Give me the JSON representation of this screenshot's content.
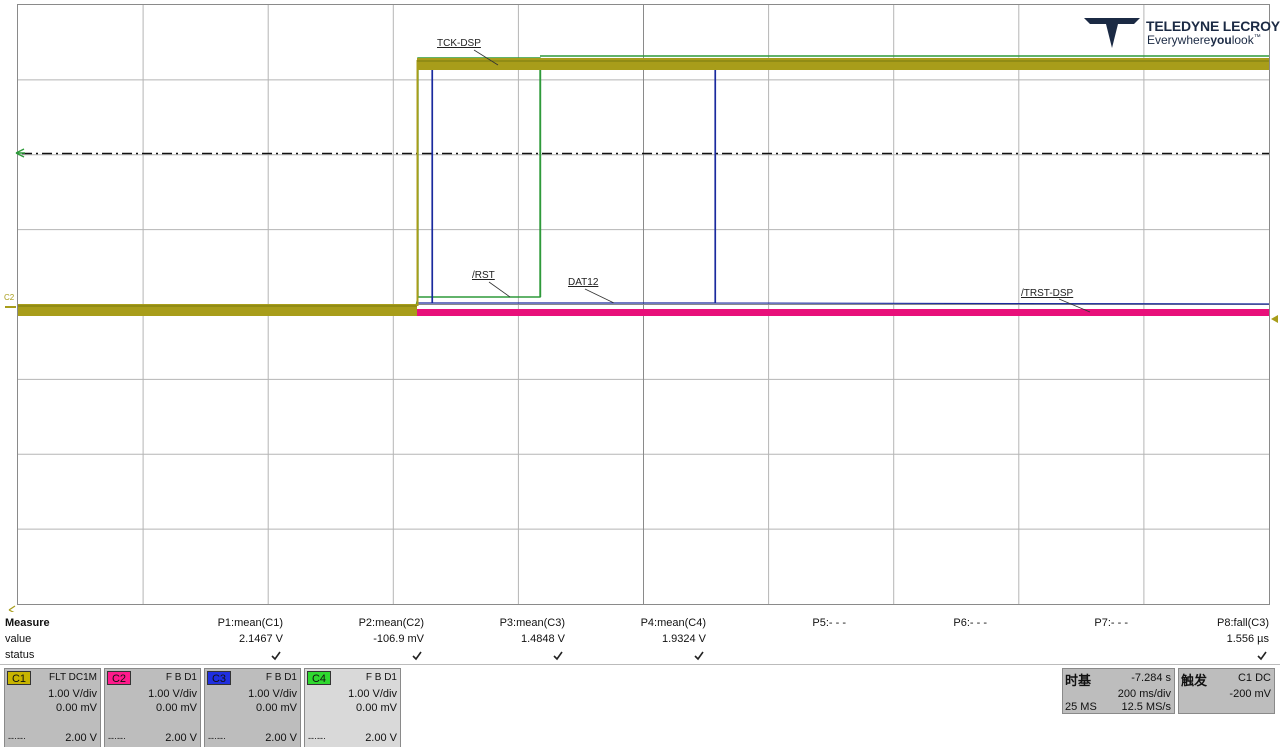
{
  "brand": {
    "name": "TELEDYNE LECROY",
    "tagline_pre": "Everywhere",
    "tagline_bold": "you",
    "tagline_post": "look",
    "tm": "™"
  },
  "trace_labels": {
    "tck": "TCK-DSP",
    "rst": "/RST",
    "dat": "DAT12",
    "trst": "/TRST-DSP",
    "c2_marker": "C2"
  },
  "measure": {
    "header": "Measure",
    "row_value": "value",
    "row_status": "status",
    "params": [
      {
        "name": "P1:mean(C1)",
        "value": "2.1467 V",
        "status": "ok"
      },
      {
        "name": "P2:mean(C2)",
        "value": "-106.9 mV",
        "status": "ok"
      },
      {
        "name": "P3:mean(C3)",
        "value": "1.4848 V",
        "status": "ok"
      },
      {
        "name": "P4:mean(C4)",
        "value": "1.9324 V",
        "status": "ok"
      },
      {
        "name": "P5:- - -",
        "value": "",
        "status": ""
      },
      {
        "name": "P6:- - -",
        "value": "",
        "status": ""
      },
      {
        "name": "P7:- - -",
        "value": "",
        "status": ""
      },
      {
        "name": "P8:fall(C3)",
        "value": "1.556 µs",
        "status": "ok"
      }
    ]
  },
  "channels": [
    {
      "tag": "C1",
      "mode": "FLT  DC1M",
      "vdiv": "1.00 V/div",
      "offset": "0.00 mV",
      "dash": "--·--·",
      "level": "2.00 V",
      "color": "#c8b400"
    },
    {
      "tag": "C2",
      "mode": "F  B  D1",
      "vdiv": "1.00 V/div",
      "offset": "0.00 mV",
      "dash": "--·--·",
      "level": "2.00 V",
      "color": "#ff1a8c"
    },
    {
      "tag": "C3",
      "mode": "F  B  D1",
      "vdiv": "1.00 V/div",
      "offset": "0.00 mV",
      "dash": "--·--·",
      "level": "2.00 V",
      "color": "#1f2fe0"
    },
    {
      "tag": "C4",
      "mode": "F  B  D1",
      "vdiv": "1.00 V/div",
      "offset": "0.00 mV",
      "dash": "--·--·",
      "level": "2.00 V",
      "color": "#2fd82f"
    }
  ],
  "timebase": {
    "title": "时基",
    "delay": "-7.284 s",
    "tdiv": "200 ms/div",
    "samples": "25 MS",
    "rate": "12.5 MS/s"
  },
  "trigger": {
    "title": "触发",
    "source": "C1  DC",
    "level": "-200 mV"
  },
  "colors": {
    "c1": "#a89d1a",
    "c2": "#e8107a",
    "c3": "#1a2a9e",
    "c4": "#2e9a3a",
    "grid": "#9a9a9a"
  }
}
